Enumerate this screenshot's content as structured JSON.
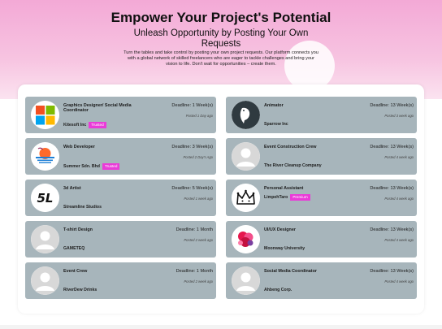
{
  "hero": {
    "title": "Empower Your Project's Potential",
    "subtitle": "Unleash Opportunity by Posting Your Own Requests",
    "description": "Turn the tables and take control by posting your own project requests. Our platform connects you with a global network of skilled freelancers who are eager to tackle challenges and bring your vision to life. Don't wait for opportunities – create them."
  },
  "requests": [
    {
      "title": "Graphics Designer/ Social Media Coordinator",
      "company": "Kitesoft Inc",
      "badge": "Trusted",
      "deadline": "Deadline: 1 Week(s)",
      "posted": "Posted 1 Day ago",
      "icon": "microsoft-logo-icon"
    },
    {
      "title": "Animator",
      "company": "Sparrow Inc",
      "badge": "",
      "deadline": "Deadline: 13 Week(s)",
      "posted": "Posted 3 week ago",
      "icon": "sparrow-logo-icon"
    },
    {
      "title": "Web Developer",
      "company": "Summer Sdn. Bhd",
      "badge": "Trusted",
      "deadline": "Deadline: 3 Week(s)",
      "posted": "Posted 2 Day's Ago",
      "icon": "summer-sunset-logo-icon"
    },
    {
      "title": "Event Construction Crew",
      "company": "The River Cleanup Company",
      "badge": "",
      "deadline": "Deadline: 13 Week(s)",
      "posted": "Posted 4 week ago",
      "icon": "default-avatar-icon"
    },
    {
      "title": "3d Artist",
      "company": "Streamline Studios",
      "badge": "",
      "deadline": "Deadline: 5 Week(s)",
      "posted": "Posted 1 week ago",
      "icon": "5l-logo-icon"
    },
    {
      "title": "Personal Assistant",
      "company": "LimpehTaro",
      "badge": "Premium",
      "deadline": "Deadline: 13 Week(s)",
      "posted": "Posted 4 week ago",
      "icon": "crown-logo-icon"
    },
    {
      "title": "T-shirt Design",
      "company": "GAMETEQ",
      "badge": "",
      "deadline": "Deadline: 1 Month",
      "posted": "Posted 2 week ago",
      "icon": "default-avatar-icon"
    },
    {
      "title": "UI/UX Designer",
      "company": "Moonway University",
      "badge": "",
      "deadline": "Deadline: 13 Week(s)",
      "posted": "Posted 4 week ago",
      "icon": "flower-logo-icon"
    },
    {
      "title": "Event Crew",
      "company": "RiverDew Drinks",
      "badge": "",
      "deadline": "Deadline: 1 Month",
      "posted": "Posted 2 week ago",
      "icon": "default-avatar-icon"
    },
    {
      "title": "Social Media Coordinator",
      "company": "Ahbeng Corp.",
      "badge": "",
      "deadline": "Deadline: 13 Week(s)",
      "posted": "Posted 4 week ago",
      "icon": "default-avatar-icon"
    }
  ],
  "colors": {
    "card_bg": "#a7b5bb",
    "badge_bg": "#ea3bd8",
    "hero_pink": "#f3a9d6"
  }
}
